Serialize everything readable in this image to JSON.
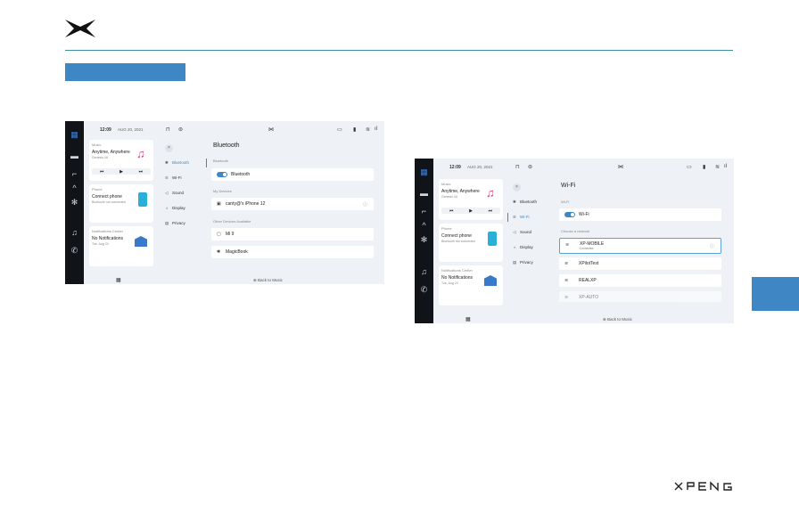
{
  "screenshot1": {
    "time": "12:09",
    "date": "AUG 20, 2021",
    "music_label": "Music",
    "song": "Anytime, Anywhere",
    "artist": "Genesis 4U",
    "phone_label": "Phone",
    "phone_title": "Connect phone",
    "phone_sub": "Bluetooth not connected",
    "notif_label": "Notifications Center",
    "notif_title": "No Notifications",
    "notif_sub": "Tue, Aug 24",
    "menu": [
      "Bluetooth",
      "Wi-Fi",
      "Sound",
      "Display",
      "Privacy"
    ],
    "panel_title": "Bluetooth",
    "section_bluetooth": "Bluetooth",
    "toggle_label": "Bluetooth",
    "section_devices": "My Devices",
    "device": "canty@'s iPhone 12",
    "section_available": "Other Devices Available",
    "avail1": "Mi 9",
    "avail2": "MagicBook",
    "back": "Back to Music"
  },
  "screenshot2": {
    "time": "12:09",
    "date": "AUG 20, 2021",
    "music_label": "Music",
    "song": "Anytime, Anywhere",
    "artist": "Genesis 4U",
    "phone_label": "Phone",
    "phone_title": "Connect phone",
    "phone_sub": "Bluetooth not connected",
    "notif_label": "Notifications Center",
    "notif_title": "No Notifications",
    "notif_sub": "Tue, Aug 24",
    "menu": [
      "Bluetooth",
      "Wi-Fi",
      "Sound",
      "Display",
      "Privacy"
    ],
    "panel_title": "Wi-Fi",
    "section_wifi": "Wi-Fi",
    "toggle_label": "Wi-Fi",
    "section_networks": "Choose a network",
    "net1": "XP-MOBILE",
    "net1_status": "Connected",
    "net2": "XPilotTest",
    "net3": "REALXP",
    "net4": "XP-AUTO",
    "back": "Back to Music"
  },
  "colors": {
    "accent": "#3f87c4",
    "rule": "#3d8fa0",
    "rail": "#101418"
  },
  "icons": [
    "xpeng-logo-icon",
    "xpeng-wordmark-icon",
    "bluetooth-icon",
    "wifi-icon",
    "sound-icon",
    "display-icon",
    "privacy-icon",
    "close-icon",
    "music-note-icon",
    "phone-icon",
    "envelope-icon",
    "grid-icon",
    "car-icon",
    "seat-icon"
  ]
}
